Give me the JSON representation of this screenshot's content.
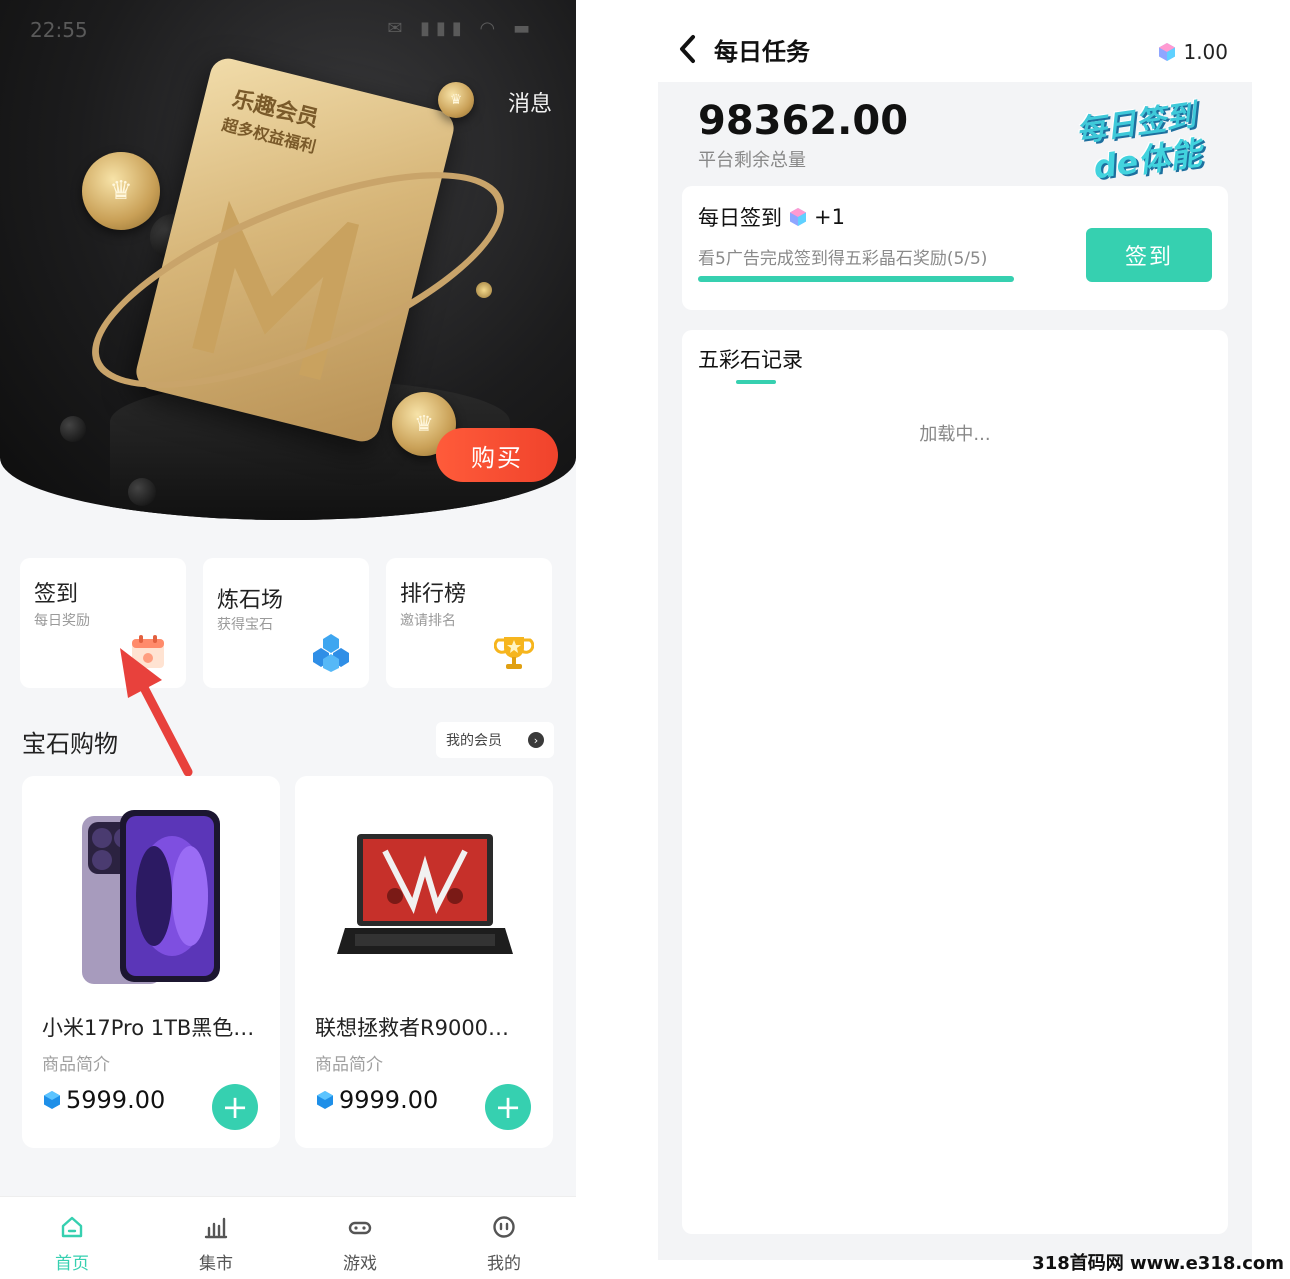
{
  "left": {
    "status_time": "22:55",
    "status_icons": "✉ ▮▮▮ ◠ ▬",
    "messages_link": "消息",
    "card": {
      "title": "乐趣会员",
      "subtitle": "超多权益福利"
    },
    "buy_button": "购买",
    "tiles": [
      {
        "title": "签到",
        "subtitle": "每日奖励",
        "icon": "calendar-icon"
      },
      {
        "title": "炼石场",
        "subtitle": "获得宝石",
        "icon": "gem-cluster-icon"
      },
      {
        "title": "排行榜",
        "subtitle": "邀请排名",
        "icon": "trophy-icon"
      }
    ],
    "shop_title": "宝石购物",
    "member_link": "我的会员",
    "products": [
      {
        "name": "小米17Pro 1TB黑色…",
        "desc": "商品简介",
        "price": "5999.00"
      },
      {
        "name": "联想拯救者R9000…",
        "desc": "商品简介",
        "price": "9999.00"
      }
    ],
    "tabs": [
      {
        "label": "首页",
        "icon": "home-icon"
      },
      {
        "label": "集市",
        "icon": "bar-chart-icon"
      },
      {
        "label": "游戏",
        "icon": "gamepad-icon"
      },
      {
        "label": "我的",
        "icon": "profile-icon"
      }
    ]
  },
  "right": {
    "title": "每日任务",
    "balance": "1.00",
    "total": "98362.00",
    "total_label": "平台剩余总量",
    "badge_line1": "每日签到",
    "badge_line2": "de体能",
    "signin_title": "每日签到",
    "signin_reward": "+1",
    "signin_desc": "看5广告完成签到得五彩晶石奖励(5/5)",
    "signin_progress": 1.0,
    "signin_button": "签到",
    "records_title": "五彩石记录",
    "loading_text": "加载中..."
  },
  "watermark": "318首码网 www.e318.com",
  "colors": {
    "accent": "#36d0b0",
    "buy": "#f0432c"
  }
}
